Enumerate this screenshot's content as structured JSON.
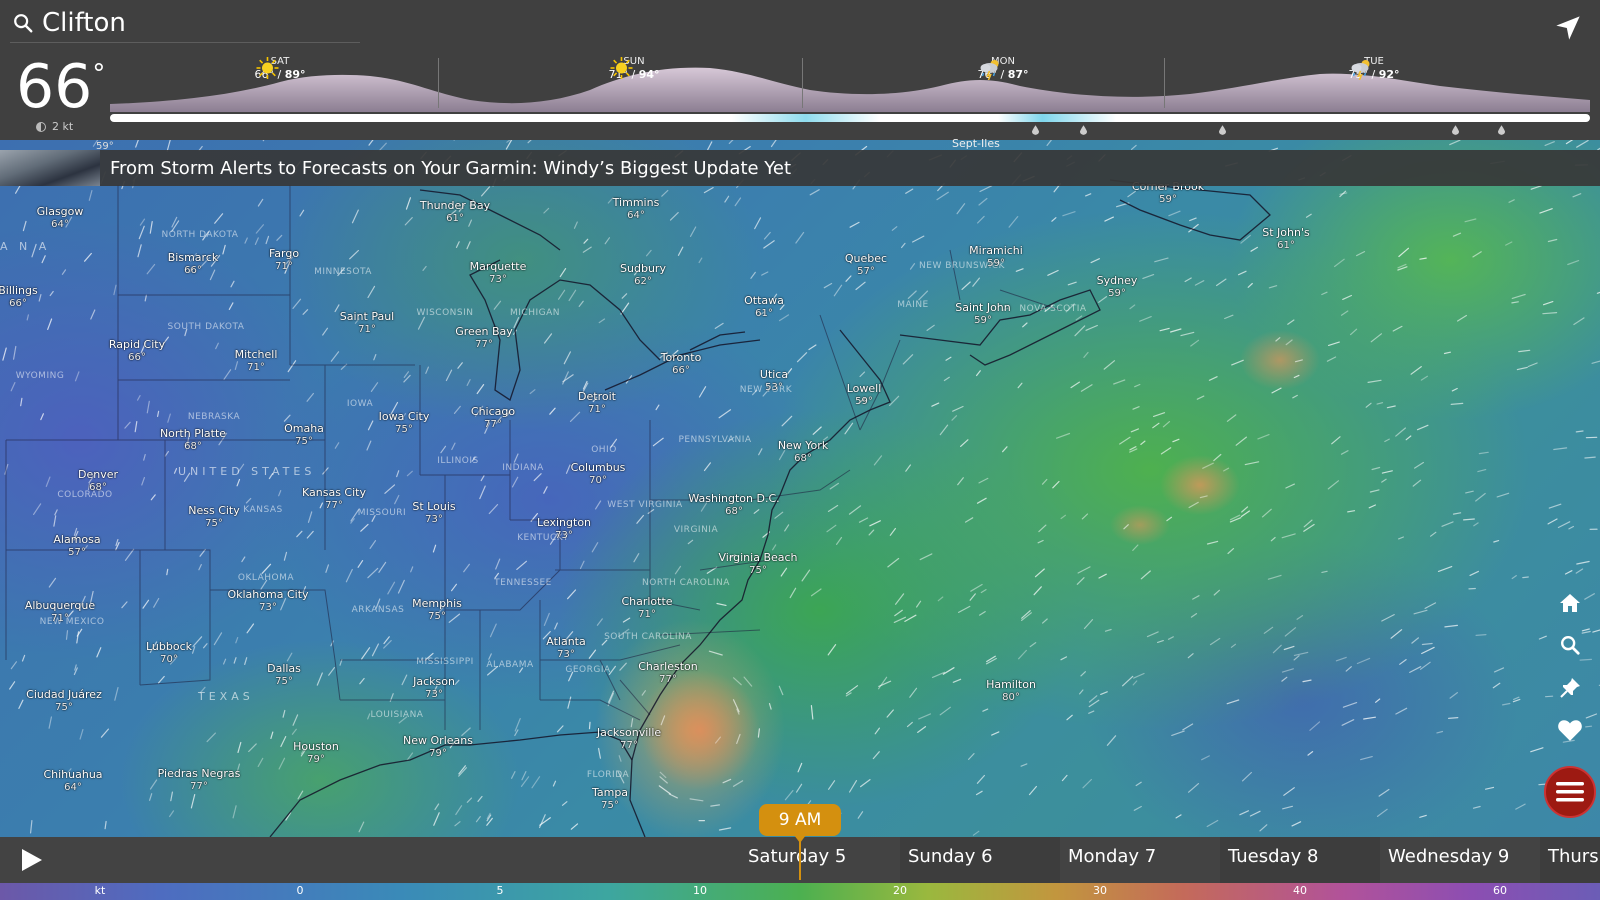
{
  "header": {
    "location": "Clifton",
    "current_temp": "66",
    "degree_symbol": "°",
    "current_wind": "2 kt",
    "days": [
      {
        "name": "SAT",
        "low": "66°",
        "high": "89°",
        "icon": "sun-icon"
      },
      {
        "name": "SUN",
        "low": "71°",
        "high": "94°",
        "icon": "sun-icon"
      },
      {
        "name": "MON",
        "low": "76°",
        "high": "87°",
        "icon": "thunderstorm-icon"
      },
      {
        "name": "TUE",
        "low": "75°",
        "high": "92°",
        "icon": "thunderstorm-icon"
      }
    ],
    "separator": " / "
  },
  "news": {
    "headline": "From Storm Alerts to Forecasts on Your Garmin: Windy’s Biggest Update Yet",
    "prefix_temp": "59°",
    "partial_place": "Sept-Iles"
  },
  "map": {
    "places": [
      {
        "name": "Glasgow",
        "temp": "64°"
      },
      {
        "name": "Bismarck",
        "temp": "66°"
      },
      {
        "name": "Fargo",
        "temp": "71°"
      },
      {
        "name": "Billings",
        "temp": "66°"
      },
      {
        "name": "Rapid City",
        "temp": "66°"
      },
      {
        "name": "Mitchell",
        "temp": "71°"
      },
      {
        "name": "Saint Paul",
        "temp": "71°"
      },
      {
        "name": "Thunder Bay",
        "temp": "61°"
      },
      {
        "name": "Marquette",
        "temp": "73°"
      },
      {
        "name": "Green Bay",
        "temp": "77°"
      },
      {
        "name": "Timmins",
        "temp": "64°"
      },
      {
        "name": "Sudbury",
        "temp": "62°"
      },
      {
        "name": "Ottawa",
        "temp": "61°"
      },
      {
        "name": "Quebec",
        "temp": "57°"
      },
      {
        "name": "Miramichi",
        "temp": "59°"
      },
      {
        "name": "Saint John",
        "temp": "59°"
      },
      {
        "name": "Sydney",
        "temp": "59°"
      },
      {
        "name": "Corner Brook",
        "temp": "59°"
      },
      {
        "name": "St John's",
        "temp": "61°"
      },
      {
        "name": "Toronto",
        "temp": "66°"
      },
      {
        "name": "Utica",
        "temp": "53°"
      },
      {
        "name": "Lowell",
        "temp": "59°"
      },
      {
        "name": "Detroit",
        "temp": "71°"
      },
      {
        "name": "Chicago",
        "temp": "77°"
      },
      {
        "name": "Iowa City",
        "temp": "75°"
      },
      {
        "name": "Omaha",
        "temp": "75°"
      },
      {
        "name": "North Platte",
        "temp": "68°"
      },
      {
        "name": "Denver",
        "temp": "68°"
      },
      {
        "name": "Kansas City",
        "temp": "77°"
      },
      {
        "name": "Ness City",
        "temp": "75°"
      },
      {
        "name": "St Louis",
        "temp": "73°"
      },
      {
        "name": "Columbus",
        "temp": "70°"
      },
      {
        "name": "New York",
        "temp": "68°"
      },
      {
        "name": "Washington D.C.",
        "temp": "68°"
      },
      {
        "name": "Lexington",
        "temp": "73°"
      },
      {
        "name": "Virginia Beach",
        "temp": "75°"
      },
      {
        "name": "Alamosa",
        "temp": "57°"
      },
      {
        "name": "Albuquerque",
        "temp": "71°"
      },
      {
        "name": "Oklahoma City",
        "temp": "73°"
      },
      {
        "name": "Memphis",
        "temp": "75°"
      },
      {
        "name": "Charlotte",
        "temp": "71°"
      },
      {
        "name": "Atlanta",
        "temp": "73°"
      },
      {
        "name": "Charleston",
        "temp": "77°"
      },
      {
        "name": "Lubbock",
        "temp": "70°"
      },
      {
        "name": "Dallas",
        "temp": "75°"
      },
      {
        "name": "Jackson",
        "temp": "73°"
      },
      {
        "name": "Ciudad Juárez",
        "temp": "75°"
      },
      {
        "name": "Houston",
        "temp": "79°"
      },
      {
        "name": "New Orleans",
        "temp": "79°"
      },
      {
        "name": "Jacksonville",
        "temp": "77°"
      },
      {
        "name": "Chihuahua",
        "temp": "64°"
      },
      {
        "name": "Piedras Negras",
        "temp": "77°"
      },
      {
        "name": "Tampa",
        "temp": "75°"
      },
      {
        "name": "Hamilton",
        "temp": "80°"
      }
    ],
    "regions": [
      "NORTH DAKOTA",
      "MINNESOTA",
      "SOUTH DAKOTA",
      "WYOMING",
      "NEBRASKA",
      "IOWA",
      "WISCONSIN",
      "MICHIGAN",
      "COLORADO",
      "KANSAS",
      "MISSOURI",
      "ILLINOIS",
      "INDIANA",
      "OHIO",
      "PENNSYLVANIA",
      "NEW YORK",
      "KENTUCKY",
      "WEST VIRGINIA",
      "VIRGINIA",
      "TENNESSEE",
      "NORTH CAROLINA",
      "SOUTH CAROLINA",
      "ARKANSAS",
      "OKLAHOMA",
      "NEW MEXICO",
      "MISSISSIPPI",
      "ALABAMA",
      "GEORGIA",
      "LOUISIANA",
      "FLORIDA",
      "MAINE",
      "NEW BRUNSWICK",
      "NOVA SCOTIA"
    ],
    "country": "UNITED STATES",
    "country2": "TEXAS",
    "canada_fragment": "A N A"
  },
  "tools": [
    "home-icon",
    "search-icon",
    "pin-icon",
    "heart-icon",
    "menu-icon"
  ],
  "timeline": {
    "current_time": "9 AM",
    "days": [
      "Saturday 5",
      "Sunday 6",
      "Monday 7",
      "Tuesday 8",
      "Wednesday 9",
      "Thurs"
    ]
  },
  "legend": {
    "unit": "kt",
    "ticks": [
      "0",
      "5",
      "10",
      "20",
      "30",
      "40",
      "60"
    ]
  },
  "colors": {
    "header_bg": "#404040",
    "accent_time": "#d4900f",
    "menu_button": "#9d1a12"
  }
}
